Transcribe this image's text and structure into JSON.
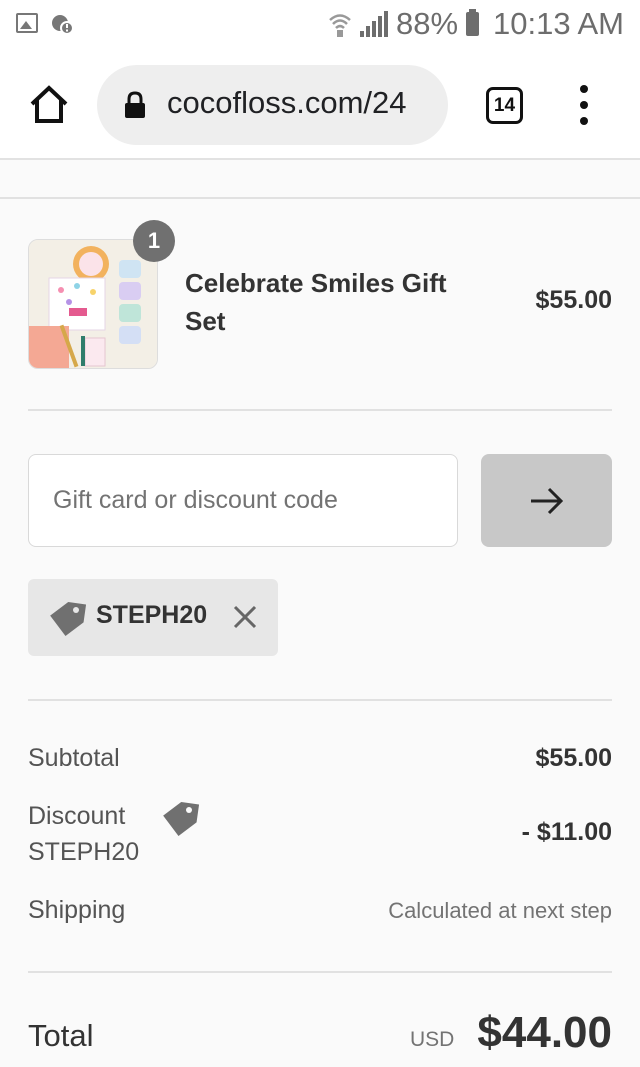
{
  "status_bar": {
    "battery": "88%",
    "time": "10:13 AM"
  },
  "browser": {
    "url": "cocofloss.com/24",
    "tab_count": "14"
  },
  "cart": {
    "item": {
      "quantity": "1",
      "name": "Celebrate Smiles Gift Set",
      "price": "$55.00"
    }
  },
  "discount": {
    "placeholder": "Gift card or discount code",
    "applied_code": "STEPH20"
  },
  "summary": {
    "subtotal_label": "Subtotal",
    "subtotal_value": "$55.00",
    "discount_label": "Discount",
    "discount_code": "STEPH20",
    "discount_value": "- $11.00",
    "shipping_label": "Shipping",
    "shipping_value": "Calculated at next step",
    "total_label": "Total",
    "currency": "USD",
    "total_value": "$44.00"
  }
}
